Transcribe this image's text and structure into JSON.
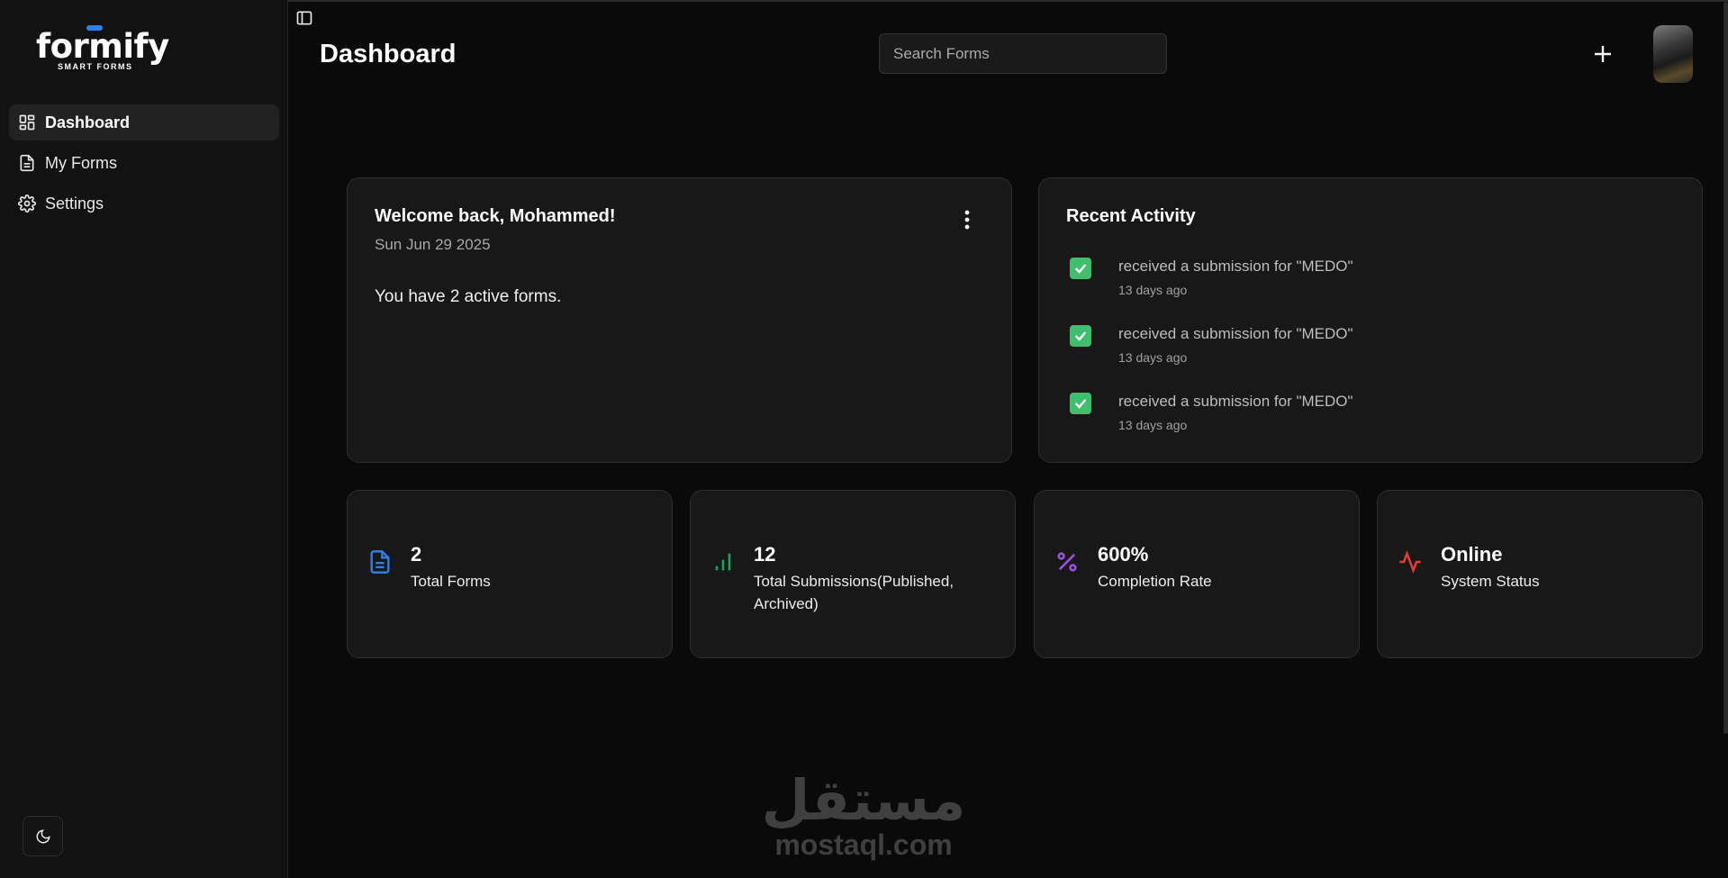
{
  "app": {
    "logo_text": "formify",
    "logo_subtitle": "SMART FORMS",
    "brand_accent": "#2f80ed"
  },
  "sidebar": {
    "items": [
      {
        "label": "Dashboard",
        "icon": "dashboard-grid-icon",
        "active": true
      },
      {
        "label": "My Forms",
        "icon": "document-icon",
        "active": false
      },
      {
        "label": "Settings",
        "icon": "gear-icon",
        "active": false
      }
    ],
    "theme_toggle_icon": "moon-icon"
  },
  "header": {
    "title": "Dashboard",
    "search_placeholder": "Search Forms",
    "add_icon": "plus-icon",
    "avatar": "user-avatar"
  },
  "welcome": {
    "title": "Welcome back, Mohammed!",
    "date": "Sun Jun 29 2025",
    "message": "You have 2 active forms."
  },
  "activity": {
    "title": "Recent Activity",
    "items": [
      {
        "text": "received a submission for \"MEDO\"",
        "time": "13 days ago"
      },
      {
        "text": "received a submission for \"MEDO\"",
        "time": "13 days ago"
      },
      {
        "text": "received a submission for \"MEDO\"",
        "time": "13 days ago"
      }
    ],
    "check_color": "#3fbf6e"
  },
  "stats": [
    {
      "value": "2",
      "label": "Total Forms",
      "icon": "document-icon",
      "color": "#2f80ed"
    },
    {
      "value": "12",
      "label": "Total Submissions(Published, Archived)",
      "icon": "bar-chart-icon",
      "color": "#22a35a"
    },
    {
      "value": "600%",
      "label": "Completion Rate",
      "icon": "percent-icon",
      "color": "#9b51e0"
    },
    {
      "value": "Online",
      "label": "System Status",
      "icon": "activity-pulse-icon",
      "color": "#e53935"
    }
  ],
  "watermark": {
    "arabic": "مستقل",
    "latin": "mostaql.com"
  }
}
